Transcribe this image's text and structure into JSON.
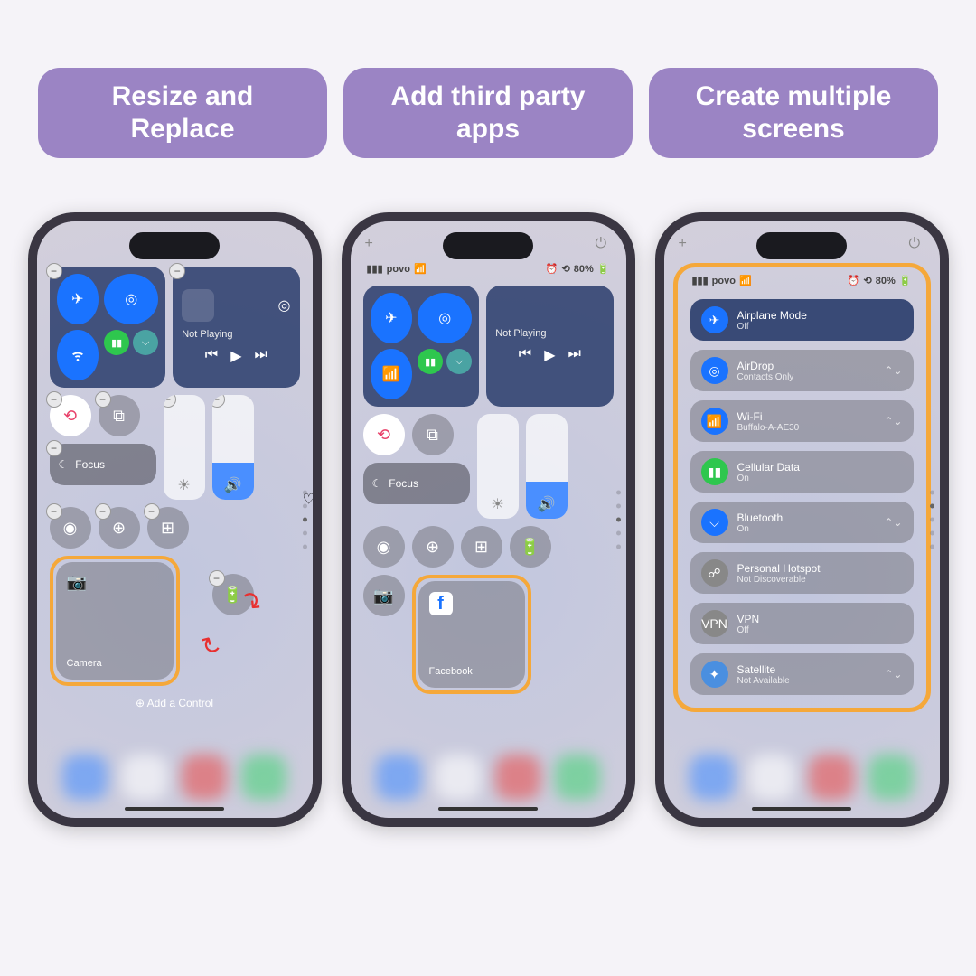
{
  "labels": [
    "Resize and Replace",
    "Add third party apps",
    "Create multiple screens"
  ],
  "status": {
    "carrier": "povo",
    "battery": "80%"
  },
  "connectivity": {
    "not_playing": "Not Playing"
  },
  "screen1": {
    "focus": "Focus",
    "camera": "Camera",
    "add_control": "Add a Control"
  },
  "screen2": {
    "focus": "Focus",
    "facebook": "Facebook"
  },
  "screen3": {
    "items": [
      {
        "name": "Airplane Mode",
        "sub": "Off",
        "color": "#1a73ff",
        "icon": "airplane"
      },
      {
        "name": "AirDrop",
        "sub": "Contacts Only",
        "color": "#1a73ff",
        "icon": "airdrop",
        "chev": true
      },
      {
        "name": "Wi-Fi",
        "sub": "Buffalo-A-AE30",
        "color": "#1a73ff",
        "icon": "wifi",
        "chev": true
      },
      {
        "name": "Cellular Data",
        "sub": "On",
        "color": "#2ec74e",
        "icon": "cell"
      },
      {
        "name": "Bluetooth",
        "sub": "On",
        "color": "#1a73ff",
        "icon": "bt",
        "chev": true
      },
      {
        "name": "Personal Hotspot",
        "sub": "Not Discoverable",
        "color": "#888",
        "icon": "hotspot"
      },
      {
        "name": "VPN",
        "sub": "Off",
        "color": "#888",
        "icon": "vpn"
      },
      {
        "name": "Satellite",
        "sub": "Not Available",
        "color": "#4a8fe0",
        "icon": "sat",
        "chev": true
      }
    ]
  }
}
